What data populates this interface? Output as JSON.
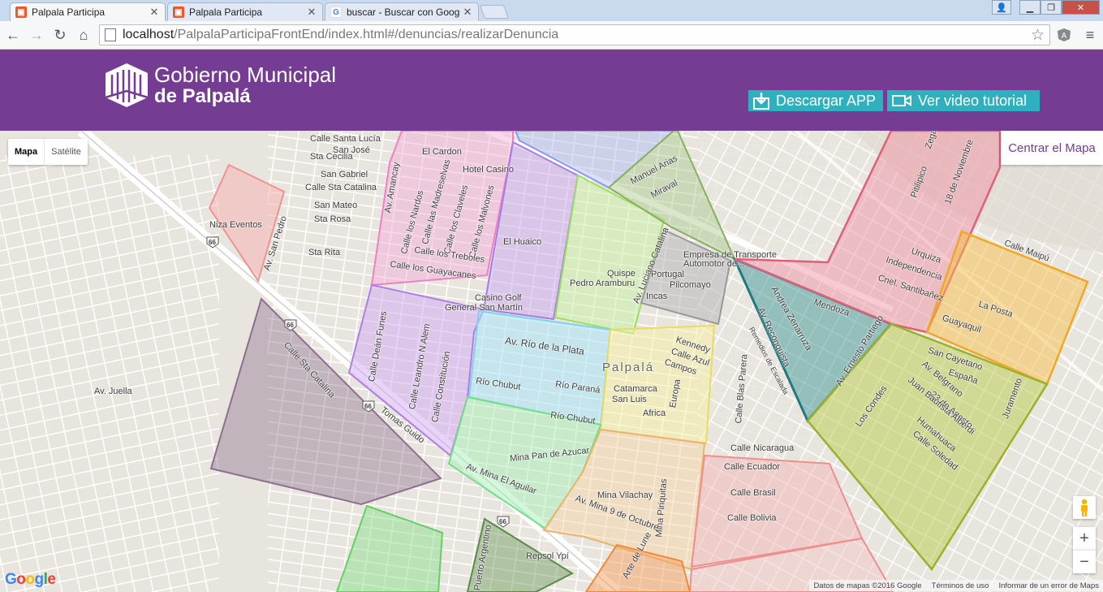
{
  "browser": {
    "tabs": [
      {
        "title": "Palpala Participa",
        "favicon": "palpala-favicon"
      },
      {
        "title": "Palpala Participa",
        "favicon": "palpala-favicon"
      },
      {
        "title": "buscar - Buscar con Goog",
        "favicon": "google-favicon"
      }
    ],
    "url_host": "localhost",
    "url_path": "/PalpalaParticipaFrontEnd/index.html#/denuncias/realizarDenuncia"
  },
  "header": {
    "logo_line1": "Gobierno Municipal",
    "logo_line2": "de Palpalá",
    "download_label": "Descargar APP",
    "video_label": "Ver video tutorial",
    "accent": "#743c93",
    "button_color": "#2fb0bf"
  },
  "map": {
    "type_options": [
      "Mapa",
      "Satélite"
    ],
    "center_button": "Centrar el Mapa",
    "zoom_in": "+",
    "zoom_out": "−",
    "google_logo": "Google",
    "footer": [
      "Datos de mapas ©2016 Google",
      "Términos de uso",
      "Informar de un error de Maps"
    ],
    "labels": {
      "l01": "Calle Santa Lucía",
      "l02": "Sta Cecilia",
      "l03": "San José",
      "l04": "San Gabriel",
      "l05": "Calle Sta Catalina",
      "l06": "San Mateo",
      "l07": "Sta Rosa",
      "l08": "Sta Rita",
      "l09": "Niza Eventos",
      "l10": "Av. San Pedro",
      "l11": "Av. Amancay",
      "l12": "El Cardon",
      "l13": "Hotel Casino",
      "l14": "Calle los Nardos",
      "l15": "Calle las Madreselvas",
      "l16": "Calle los Claveles",
      "l17": "Calle los Malvones",
      "l18": "Calle los Treboles",
      "l19": "Calle los Guayacanes",
      "l20": "El Huaico",
      "l21": "Casino Golf",
      "l22": "General San Martín",
      "l23": "Manuel Arias",
      "l24": "Miraval",
      "l25": "Quispe",
      "l26": "Pedro Aramburu",
      "l27": "Empresa de Transporte",
      "l28": "Automotor de...",
      "l29": "Portugal",
      "l30": "Pilcomayo",
      "l31": "Incas",
      "l32": "Av. Luciano Catalina",
      "l33": "Calle Deán Funes",
      "l34": "Calle Leandro N Alem",
      "l35": "Calle Constitución",
      "l36": "Av. Río de la Plata",
      "l37": "Río Chubut",
      "l38": "Río Paraná",
      "l39": "Río Chubut",
      "l40": "Palpalá",
      "l41": "Kennedy",
      "l42": "Calle Azul",
      "l43": "Campos",
      "l44": "Catamarca",
      "l45": "San Luis",
      "l46": "Europa",
      "l47": "Africa",
      "l48": "Calle Blas Parera",
      "l49": "Calle Nicaragua",
      "l50": "Calle Ecuador",
      "l51": "Calle Brasil",
      "l52": "Calle Bolivia",
      "l53": "Mina Pan de Azucar",
      "l54": "Av. Mina El Aguilar",
      "l55": "Mina Vilachay",
      "l56": "Mina Piriquitas",
      "l57": "Av. Mina 9 de Octubre",
      "l58": "Repsol Ypí",
      "l59": "Puerto Argentino",
      "l60": "Calle Sta Catalina",
      "l61": "Tomas Guido",
      "l62": "Av. Juella",
      "l63": "Andrea Zenarruza",
      "l64": "Av. Reconquista",
      "l65": "Mendoza",
      "l66": "Av. Ernesto Partiego",
      "l67": "Urquiza",
      "l68": "Independencia",
      "l69": "Cnel. Santibañez",
      "l70": "Pitilipico",
      "l71": "18 de Noviembre",
      "l72": "Zegada",
      "l73": "Calle Maipú",
      "l74": "La Posta",
      "l75": "Guayaquil",
      "l76": "San Cayetano",
      "l77": "España",
      "l78": "Av. Belgrano",
      "l79": "23 de Agosto",
      "l80": "Juan Bautista Alberdi",
      "l81": "Humahuaca",
      "l82": "Calle Soledad",
      "l83": "Los Condes",
      "l84": "Juramento",
      "l85": "66",
      "l86": "66",
      "l87": "66",
      "l88": "66",
      "l89": "Remedios de Escalada",
      "l90": "Mina Pirquitas",
      "l91": "Arte de Lune",
      "l92": "Rio Chubut"
    }
  }
}
